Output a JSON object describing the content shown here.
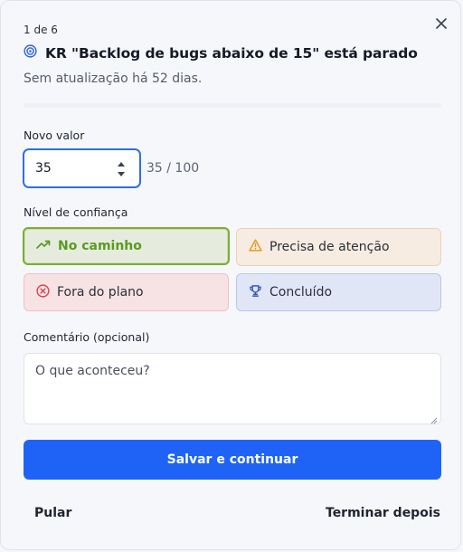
{
  "header": {
    "counter": "1 de 6",
    "title": "KR \"Backlog de bugs abaixo de 15\" está parado",
    "subtitle": "Sem atualização há 52 dias.",
    "progress_fraction": 0.0
  },
  "value_field": {
    "label": "Novo valor",
    "value": "35",
    "of_total": "35 / 100"
  },
  "confidence": {
    "label": "Nível de confiança",
    "options": [
      {
        "label": "No caminho",
        "icon": "trending-up-icon",
        "color": "#5a9a22",
        "selected": true
      },
      {
        "label": "Precisa de atenção",
        "icon": "warning-icon",
        "color": "#e59a1f",
        "selected": false
      },
      {
        "label": "Fora do plano",
        "icon": "x-circle-icon",
        "color": "#e0404c",
        "selected": false
      },
      {
        "label": "Concluído",
        "icon": "trophy-icon",
        "color": "#2f56c8",
        "selected": false
      }
    ]
  },
  "comment": {
    "label": "Comentário (opcional)",
    "placeholder": "O que aconteceu?"
  },
  "actions": {
    "primary": "Salvar e continuar",
    "skip": "Pular",
    "later": "Terminar depois"
  },
  "colors": {
    "primary": "#1f63f6",
    "focus": "#2f6fe0"
  }
}
